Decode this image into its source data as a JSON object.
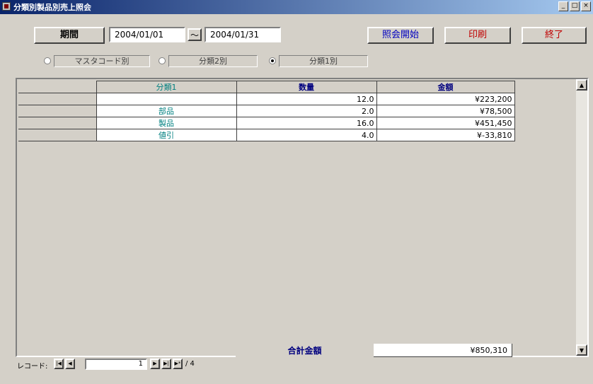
{
  "window": {
    "title": "分類別製品別売上照会"
  },
  "toolbar": {
    "period_label": "期間",
    "date_from": "2004/01/01",
    "tilde": "〜",
    "date_to": "2004/01/31",
    "start_label": "照会開始",
    "print_label": "印刷",
    "exit_label": "終了"
  },
  "radios": [
    {
      "label": "マスタコード別",
      "checked": false
    },
    {
      "label": "分類2別",
      "checked": false
    },
    {
      "label": "分類1別",
      "checked": true
    }
  ],
  "table": {
    "headers": [
      "分類1",
      "数量",
      "金額"
    ],
    "rows": [
      {
        "name": "",
        "qty": "12.0",
        "amount": "¥223,200"
      },
      {
        "name": "部品",
        "qty": "2.0",
        "amount": "¥78,500"
      },
      {
        "name": "製品",
        "qty": "16.0",
        "amount": "¥451,450"
      },
      {
        "name": "値引",
        "qty": "4.0",
        "amount": "¥-33,810"
      }
    ]
  },
  "total": {
    "label": "合計金額",
    "value": "¥850,310"
  },
  "nav": {
    "label": "レコード:",
    "current": "1",
    "total_text": "/ 4"
  }
}
